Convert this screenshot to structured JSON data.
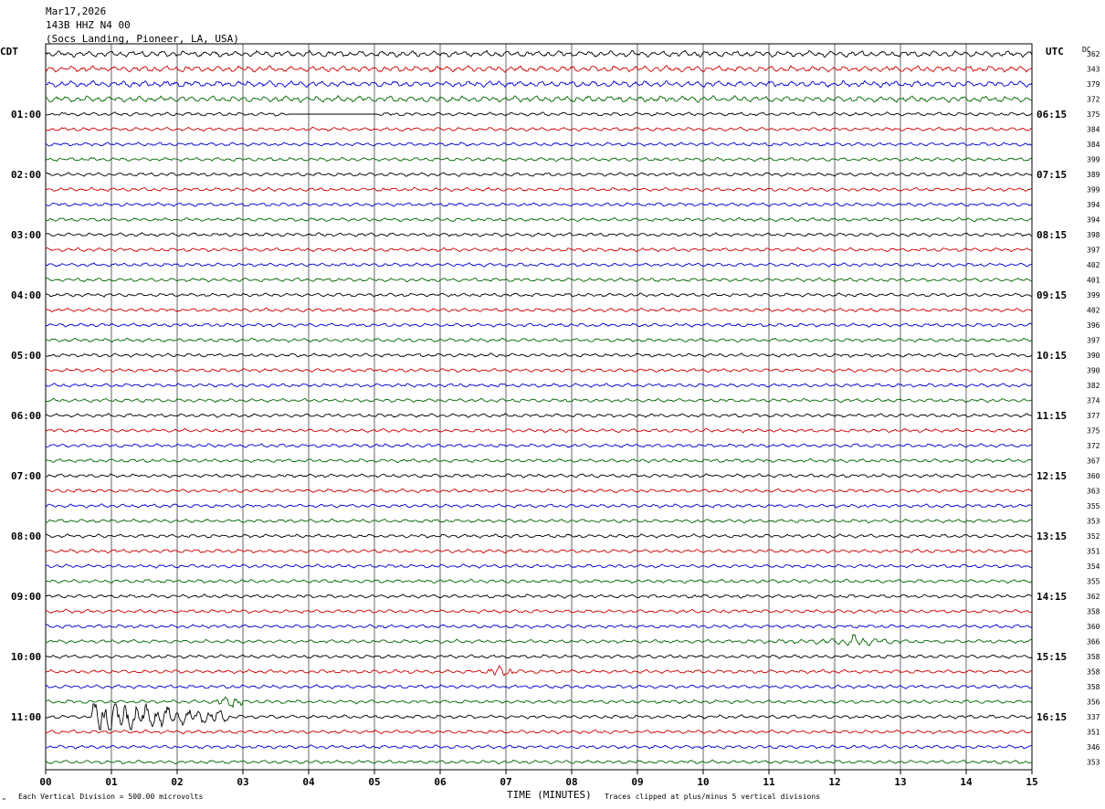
{
  "header": {
    "date": "Mar17,2026",
    "station": "143B HHZ N4 00",
    "location": "(Socs Landing, Pioneer, LA, USA)"
  },
  "labels": {
    "left_tz": "CDT",
    "right_tz": "UTC",
    "dc": "DC"
  },
  "footer": {
    "scale": "Each Vertical Division =  500.00 microvolts",
    "x_title": "TIME (MINUTES)",
    "clip_note": "Traces clipped at plus/minus 5 vertical divisions",
    "corner_mark": "\""
  },
  "colors": {
    "trace_cycle": [
      "#000000",
      "#cc0000",
      "#0000cc",
      "#006600"
    ],
    "grid": "#000000",
    "background": "#ffffff"
  },
  "chart_data": {
    "type": "line",
    "title": "",
    "xlabel": "TIME (MINUTES)",
    "xlim": [
      0,
      15
    ],
    "x_ticks": [
      "00",
      "01",
      "02",
      "03",
      "04",
      "05",
      "06",
      "07",
      "08",
      "09",
      "10",
      "11",
      "12",
      "13",
      "14",
      "15"
    ],
    "rows_per_hour": 4,
    "row_count": 48,
    "left_time_labels": [
      "01:00",
      "02:00",
      "03:00",
      "04:00",
      "05:00",
      "06:00",
      "07:00",
      "08:00",
      "09:00",
      "10:00",
      "11:00"
    ],
    "right_time_labels": [
      "06:15",
      "07:15",
      "08:15",
      "09:15",
      "10:15",
      "11:15",
      "12:15",
      "13:15",
      "14:15",
      "15:15",
      "16:15"
    ],
    "dc_offsets": [
      362,
      343,
      379,
      372,
      375,
      384,
      384,
      399,
      389,
      399,
      394,
      394,
      398,
      397,
      402,
      401,
      399,
      402,
      396,
      397,
      390,
      390,
      382,
      374,
      377,
      375,
      372,
      367,
      360,
      363,
      355,
      353,
      352,
      351,
      354,
      355,
      362,
      358,
      360,
      366,
      358,
      358,
      358,
      356,
      337,
      351,
      346,
      353
    ],
    "events": [
      {
        "row": 44,
        "start_min": 0.7,
        "end_min": 2.8,
        "peak_min": 0.95,
        "label": "recorded event"
      },
      {
        "row": 41,
        "start_min": 6.7,
        "end_min": 7.1,
        "peak_min": 6.9,
        "label": "burst"
      },
      {
        "row": 39,
        "start_min": 10.3,
        "end_min": 13.0,
        "peak_min": 12.3,
        "label": "burst"
      },
      {
        "row": 43,
        "start_min": 2.6,
        "end_min": 3.0,
        "peak_min": 2.8,
        "label": "burst"
      },
      {
        "row": 4,
        "start_min": 3.7,
        "end_min": 5.05,
        "peak_min": 5.05,
        "label": "flat segment"
      }
    ]
  }
}
